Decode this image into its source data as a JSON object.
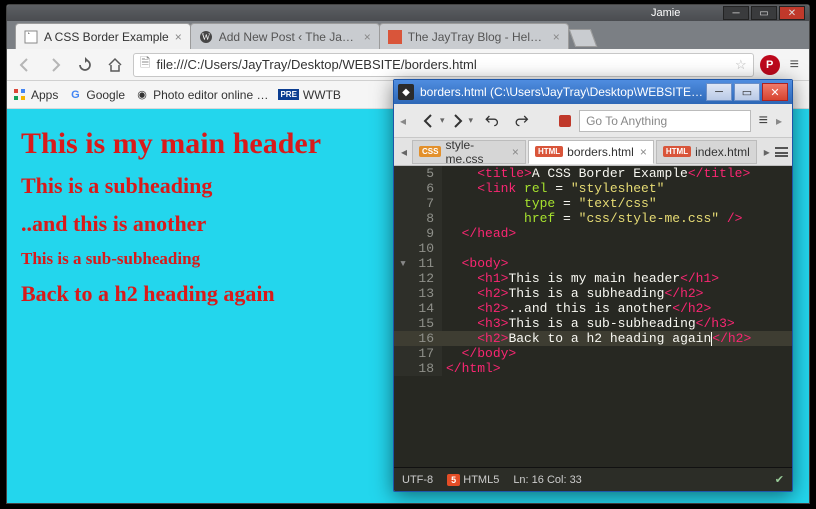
{
  "chrome": {
    "user_label": "Jamie",
    "tabs": [
      {
        "label": "A CSS Border Example",
        "active": true
      },
      {
        "label": "Add New Post ‹ The JayTr…",
        "active": false
      },
      {
        "label": "The JayTray Blog - Helpin…",
        "active": false
      }
    ],
    "url": "file:///C:/Users/JayTray/Desktop/WEBSITE/borders.html",
    "bookmarks": {
      "apps": "Apps",
      "google": "Google",
      "photo": "Photo editor online …",
      "wwtb": "WWTB"
    }
  },
  "page": {
    "h1": "This is my main header",
    "h2a": "This is a subheading",
    "h2b": "..and this is another",
    "h3": "This is a sub-subheading",
    "h2c": "Back to a h2 heading again"
  },
  "komodo": {
    "title": "borders.html (C:\\Users\\JayTray\\Desktop\\WEBSITE) - Ko…",
    "goto_placeholder": "Go To Anything",
    "tabs": {
      "style": "style-me.css",
      "borders": "borders.html",
      "index": "index.html"
    },
    "status": {
      "encoding": "UTF-8",
      "lang": "HTML5",
      "pos": "Ln: 16 Col: 33"
    },
    "code": {
      "l5": {
        "num": "5",
        "indent": "    ",
        "open": "<title>",
        "text": "A CSS Border Example",
        "close": "</title>"
      },
      "l6": {
        "num": "6",
        "indent": "    ",
        "open": "<link ",
        "a1": "rel",
        "eq": " = ",
        "v1": "\"stylesheet\""
      },
      "l7": {
        "num": "7",
        "indent": "          ",
        "a1": "type",
        "eq": " = ",
        "v1": "\"text/css\""
      },
      "l8": {
        "num": "8",
        "indent": "          ",
        "a1": "href",
        "eq": " = ",
        "v1": "\"css/style-me.css\"",
        "tail": " />"
      },
      "l9": {
        "num": "9",
        "indent": "  ",
        "close": "</head>"
      },
      "l10": {
        "num": "10",
        "indent": ""
      },
      "l11": {
        "num": "11",
        "indent": "  ",
        "open": "<body>"
      },
      "l12": {
        "num": "12",
        "indent": "    ",
        "open": "<h1>",
        "text": "This is my main header",
        "close": "</h1>"
      },
      "l13": {
        "num": "13",
        "indent": "    ",
        "open": "<h2>",
        "text": "This is a subheading",
        "close": "</h2>"
      },
      "l14": {
        "num": "14",
        "indent": "    ",
        "open": "<h2>",
        "text": "..and this is another",
        "close": "</h2>"
      },
      "l15": {
        "num": "15",
        "indent": "    ",
        "open": "<h3>",
        "text": "This is a sub-subheading",
        "close": "</h3>"
      },
      "l16": {
        "num": "16",
        "indent": "    ",
        "open": "<h2>",
        "text": "Back to a h2 heading again",
        "close": "</h2>"
      },
      "l17": {
        "num": "17",
        "indent": "  ",
        "close": "</body>"
      },
      "l18": {
        "num": "18",
        "indent": "",
        "close": "</html>"
      }
    }
  }
}
